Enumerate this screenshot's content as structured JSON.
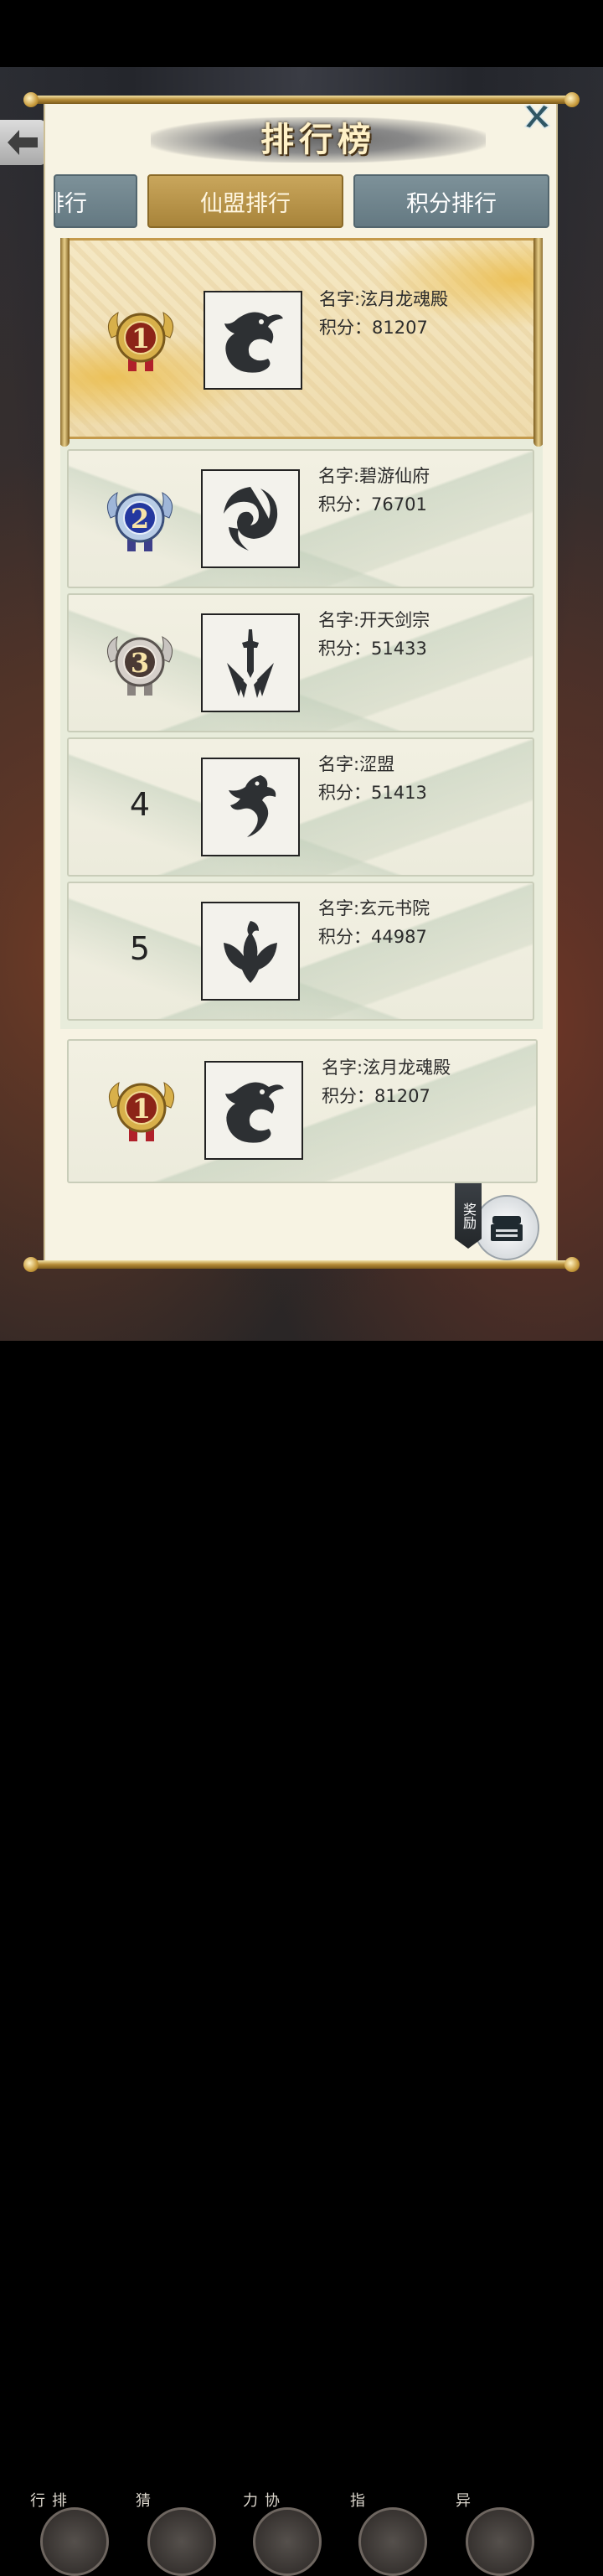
{
  "title": "排行榜",
  "tabs": [
    {
      "label": "排行",
      "active": false
    },
    {
      "label": "仙盟排行",
      "active": true
    },
    {
      "label": "积分排行",
      "active": false
    }
  ],
  "rows": [
    {
      "rank": "1",
      "name": "名字:泫月龙魂殿",
      "score": "积分：81207",
      "emblem": "dragon-coil-icon",
      "medal": "gold"
    },
    {
      "rank": "2",
      "name": "名字:碧游仙府",
      "score": "积分：76701",
      "emblem": "swirl-icon",
      "medal": "blue"
    },
    {
      "rank": "3",
      "name": "名字:开天剑宗",
      "score": "积分：51433",
      "emblem": "sword-icon",
      "medal": "bronze"
    },
    {
      "rank": "4",
      "name": "名字:涩盟",
      "score": "积分：51413",
      "emblem": "dragon-icon",
      "medal": ""
    },
    {
      "rank": "5",
      "name": "名字:玄元书院",
      "score": "积分：44987",
      "emblem": "phoenix-icon",
      "medal": ""
    }
  ],
  "my_rank": {
    "rank": "1",
    "name": "名字:泫月龙魂殿",
    "score": "积分：81207",
    "emblem": "dragon-coil-icon",
    "medal": "gold"
  },
  "reward_label": "奖励",
  "bottom_labels": [
    "排行",
    "猜",
    "协力",
    "指",
    "异"
  ],
  "colors": {
    "panel": "#f7f3e3",
    "tab_active": "#b8954a",
    "tab_inactive": "#71868e",
    "gold": "#c89b3c"
  }
}
